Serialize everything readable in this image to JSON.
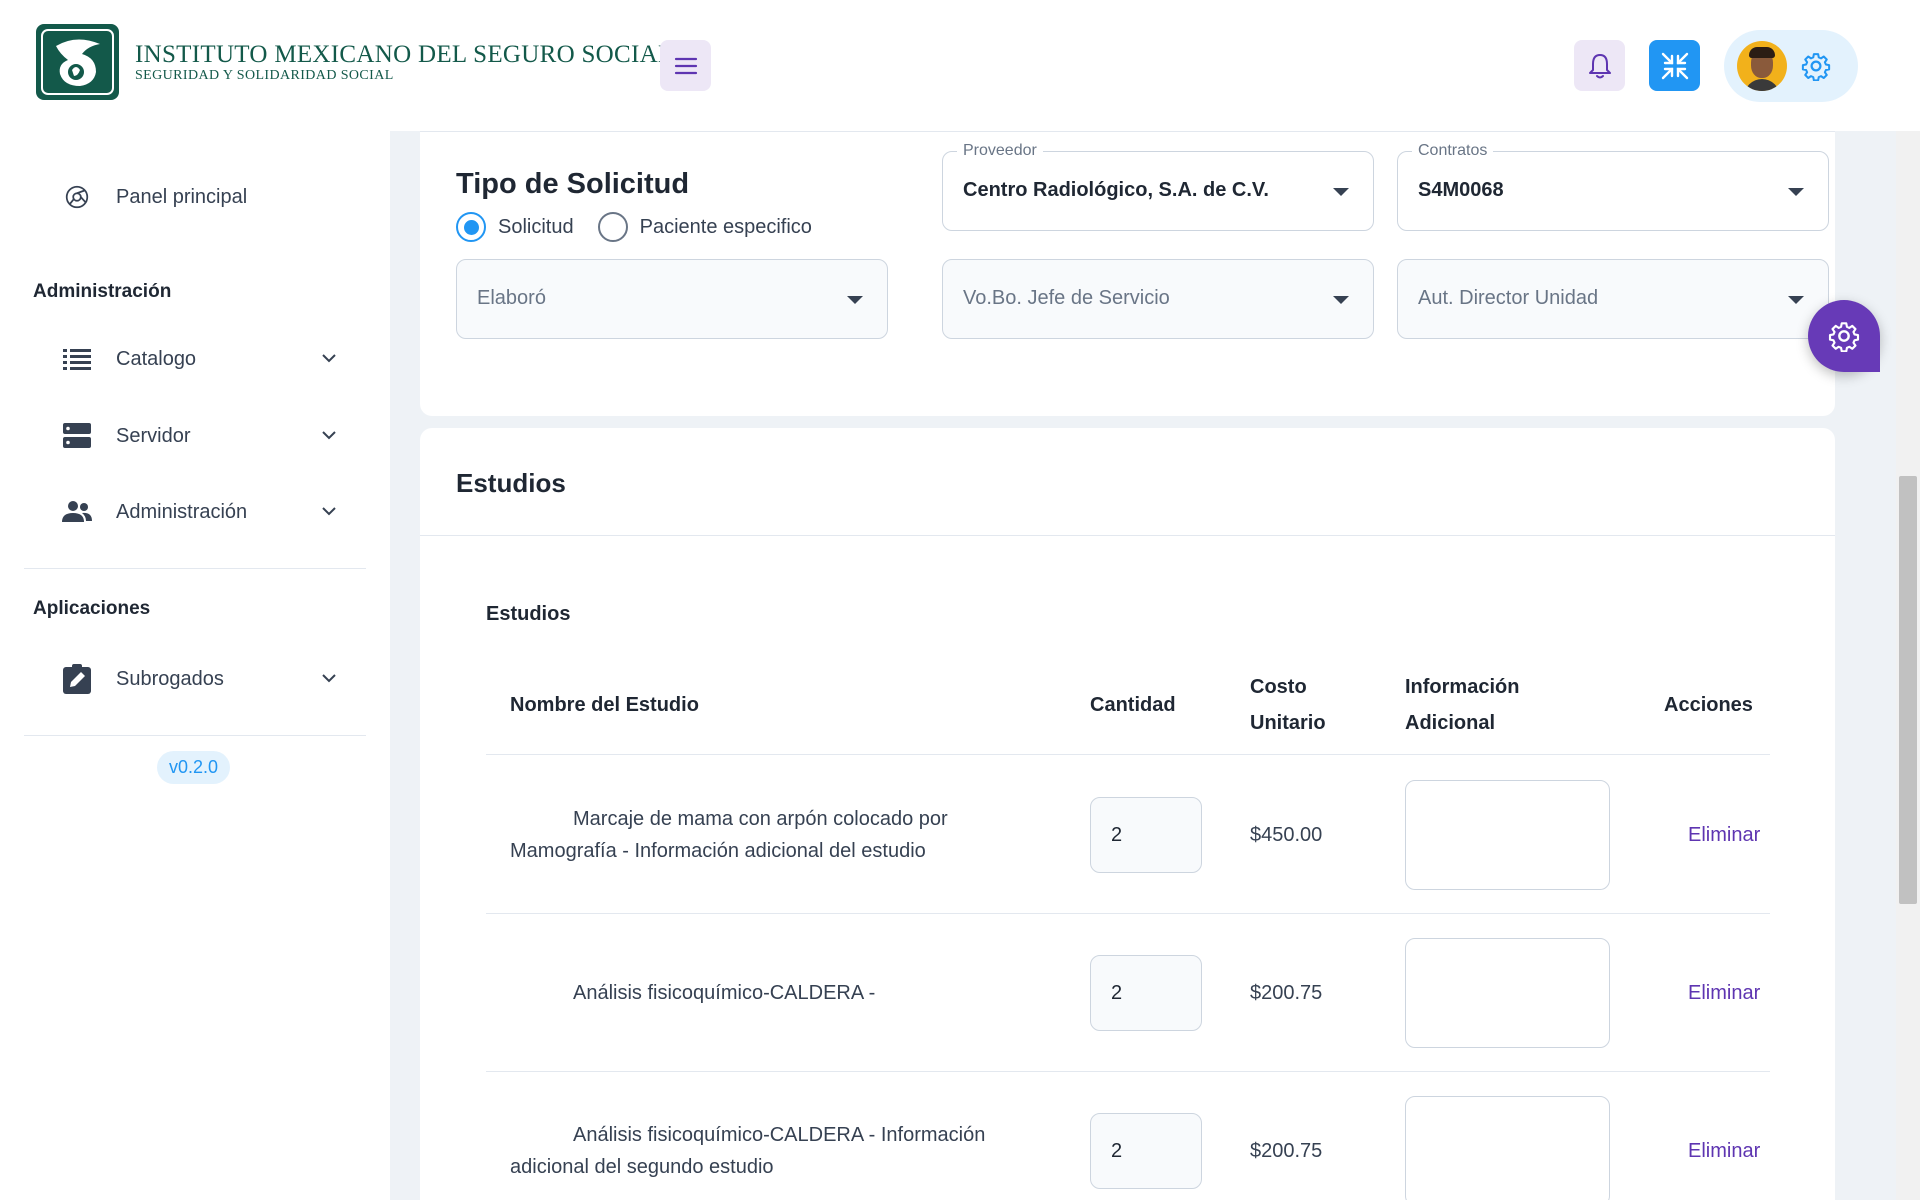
{
  "header": {
    "logo_line1": "INSTITUTO MEXICANO DEL SEGURO SOCIAL",
    "logo_line2": "SEGURIDAD Y SOLIDARIDAD SOCIAL",
    "icons": [
      "menu-icon",
      "bell-icon",
      "fullscreen-exit-icon",
      "settings-icon"
    ]
  },
  "sidebar": {
    "dashboard_label": "Panel principal",
    "section_admin": "Administración",
    "items": [
      {
        "label": "Catalogo",
        "icon": "list-icon"
      },
      {
        "label": "Servidor",
        "icon": "server-icon"
      },
      {
        "label": "Administración",
        "icon": "users-icon"
      }
    ],
    "section_apps": "Aplicaciones",
    "apps": [
      {
        "label": "Subrogados",
        "icon": "clipboard-edit-icon"
      }
    ],
    "version": "v0.2.0"
  },
  "solicitud": {
    "title": "Tipo de Solicitud",
    "radio_options": [
      "Solicitud",
      "Paciente especifico"
    ],
    "selected_radio": "Solicitud",
    "proveedor": {
      "legend": "Proveedor",
      "value": "Centro Radiológico, S.A. de C.V."
    },
    "contratos": {
      "legend": "Contratos",
      "value": "S4M0068"
    },
    "elaboro": {
      "placeholder": "Elaboró"
    },
    "vobo": {
      "placeholder": "Vo.Bo. Jefe de Servicio"
    },
    "aut": {
      "placeholder": "Aut. Director Unidad"
    }
  },
  "estudios": {
    "card_title": "Estudios",
    "sub_title": "Estudios",
    "columns": {
      "nombre": "Nombre del Estudio",
      "cantidad": "Cantidad",
      "costo_1": "Costo",
      "costo_2": "Unitario",
      "info_1": "Información",
      "info_2": "Adicional",
      "acciones": "Acciones"
    },
    "rows": [
      {
        "nombre": "Marcaje de mama con arpón colocado por Mamografía - Información adicional del estudio",
        "cantidad": "2",
        "costo": "$450.00",
        "accion": "Eliminar"
      },
      {
        "nombre": "Análisis fisicoquímico-CALDERA -",
        "cantidad": "2",
        "costo": "$200.75",
        "accion": "Eliminar"
      },
      {
        "nombre": "Análisis fisicoquímico-CALDERA - Información adicional del segundo estudio",
        "cantidad": "2",
        "costo": "$200.75",
        "accion": "Eliminar"
      }
    ]
  },
  "colors": {
    "primary": "#2196f3",
    "secondary": "#673ab7",
    "brand": "#13594a"
  }
}
